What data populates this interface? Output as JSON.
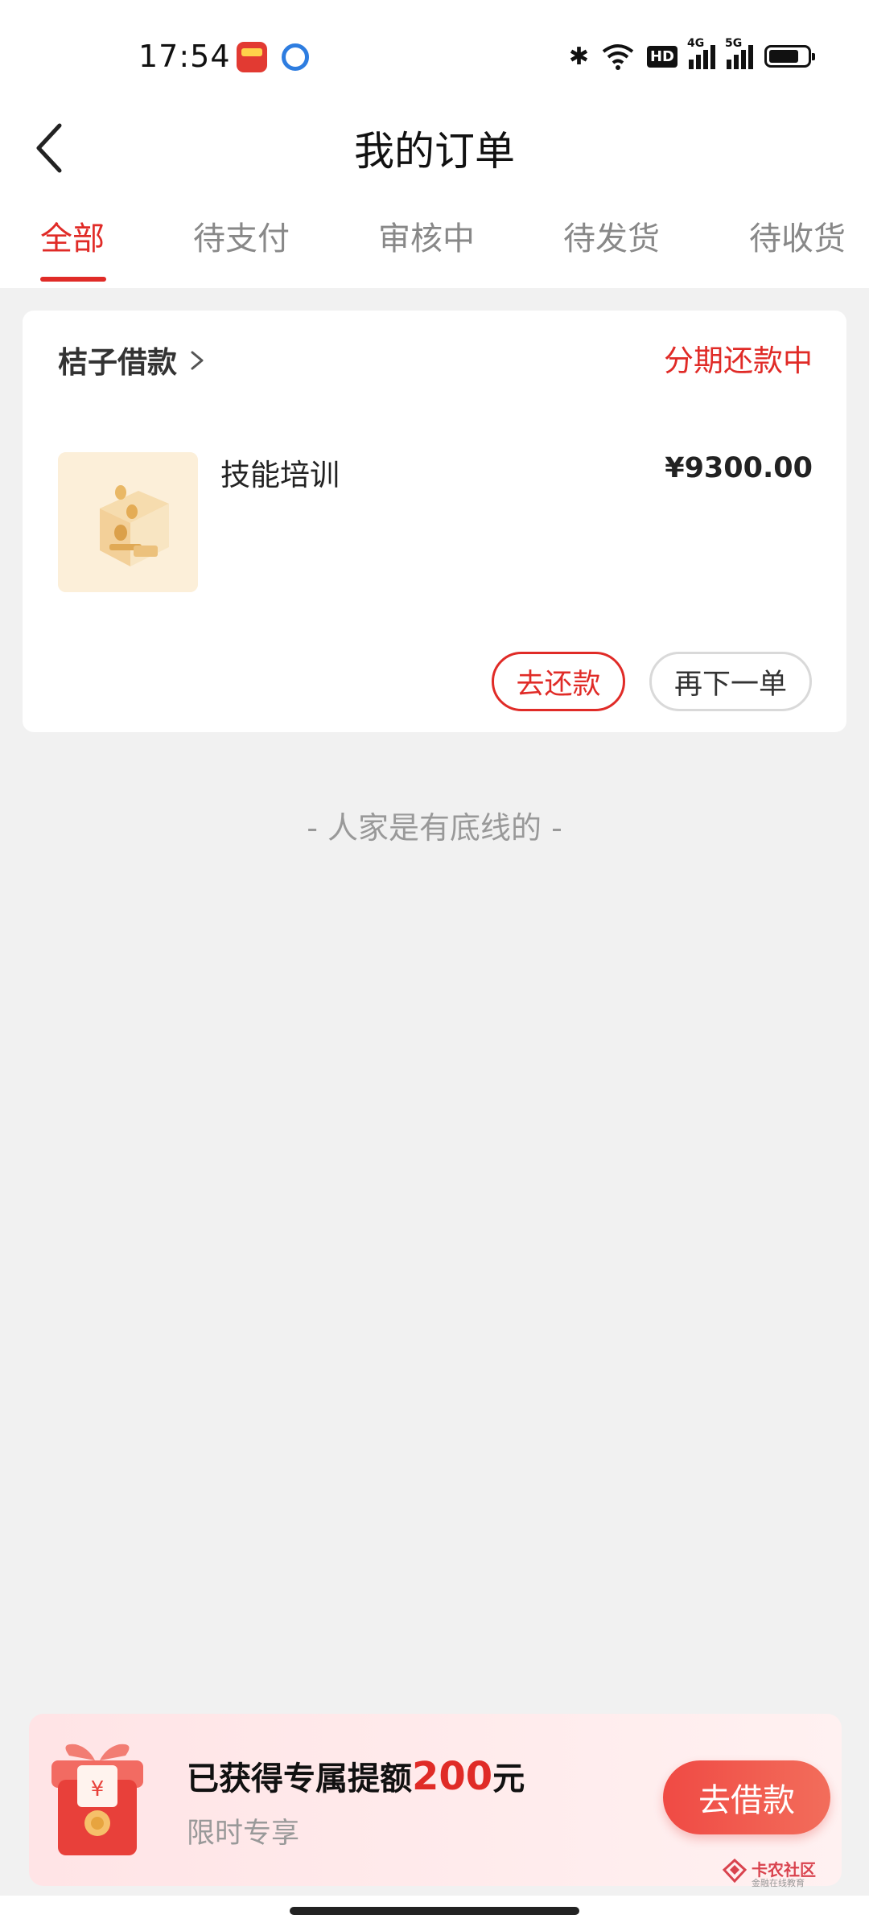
{
  "status_bar": {
    "time": "17:54",
    "icons": [
      "app-notification-icon",
      "browser-notification-icon",
      "bluetooth-icon",
      "wifi-icon",
      "hd-icon",
      "signal-4g-icon",
      "signal-5g-icon",
      "battery-icon"
    ],
    "hd_label": "HD",
    "signal_4g_label": "4G",
    "signal_5g_label": "5G"
  },
  "header": {
    "title": "我的订单",
    "back_icon": "back-arrow-icon"
  },
  "tabs": [
    {
      "label": "全部",
      "active": true
    },
    {
      "label": "待支付",
      "active": false
    },
    {
      "label": "审核中",
      "active": false
    },
    {
      "label": "待发货",
      "active": false
    },
    {
      "label": "待收货",
      "active": false
    }
  ],
  "order": {
    "merchant": "桔子借款",
    "status": "分期还款中",
    "product_name": "技能培训",
    "price": "¥9300.00",
    "actions": {
      "repay": "去还款",
      "reorder": "再下一单"
    }
  },
  "list_end_text": "- 人家是有底线的 -",
  "promo": {
    "title_prefix": "已获得专属提额",
    "amount": "200",
    "title_suffix": "元",
    "subtitle": "限时专享",
    "button_label": "去借款",
    "gift_symbol": "¥"
  },
  "watermark": {
    "text": "卡农社区",
    "subtext": "金融在线教育"
  },
  "colors": {
    "accent": "#e02b27",
    "background": "#f1f1f1"
  }
}
